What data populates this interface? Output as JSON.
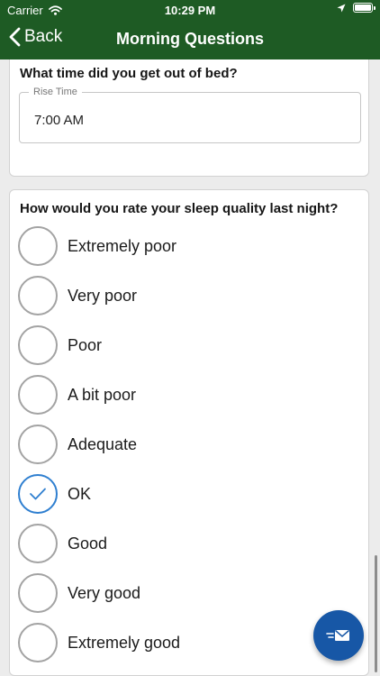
{
  "status_bar": {
    "carrier": "Carrier",
    "time": "10:29 PM"
  },
  "nav": {
    "back_label": "Back",
    "title": "Morning Questions"
  },
  "rise_question": {
    "question": "What time did you get out of bed?",
    "field_label": "Rise Time",
    "field_value": "7:00 AM"
  },
  "sleep_quality": {
    "question": "How would you rate your sleep quality last night?",
    "selected": "OK",
    "options": [
      {
        "label": "Extremely poor",
        "checked": false
      },
      {
        "label": "Very poor",
        "checked": false
      },
      {
        "label": "Poor",
        "checked": false
      },
      {
        "label": "A bit poor",
        "checked": false
      },
      {
        "label": "Adequate",
        "checked": false
      },
      {
        "label": "OK",
        "checked": true
      },
      {
        "label": "Good",
        "checked": false
      },
      {
        "label": "Very good",
        "checked": false
      },
      {
        "label": "Extremely good",
        "checked": false
      }
    ]
  },
  "fab": {
    "icon": "send-mail-icon"
  },
  "colors": {
    "header": "#1e5b24",
    "accent": "#2f7fd0",
    "fab": "#1757a6"
  }
}
